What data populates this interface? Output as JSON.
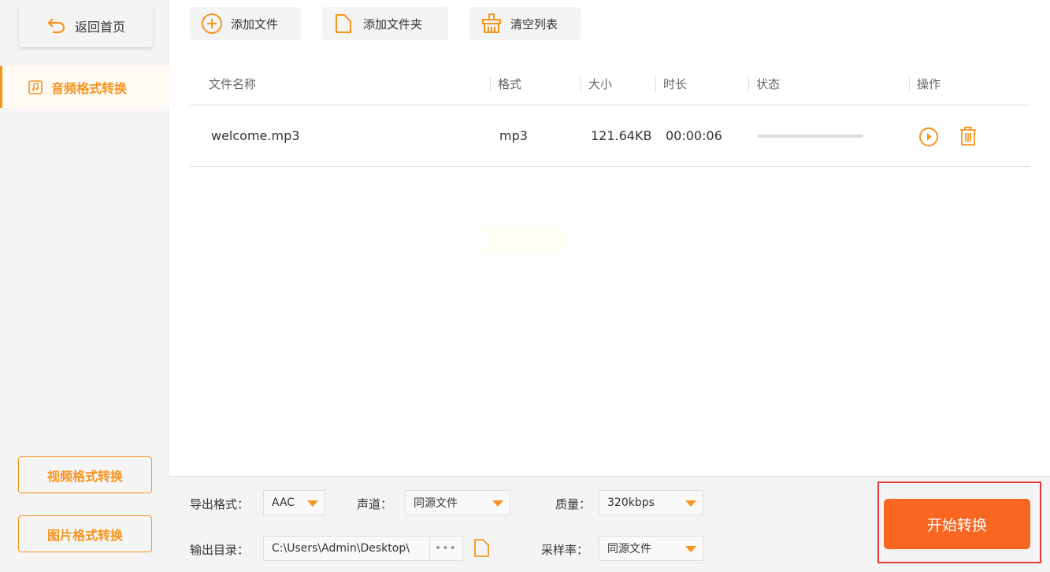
{
  "sidebar": {
    "back_label": "返回首页",
    "active_item": "音频格式转换",
    "video_label": "视频格式转换",
    "image_label": "图片格式转换"
  },
  "toolbar": {
    "add_file": "添加文件",
    "add_folder": "添加文件夹",
    "clear_list": "清空列表"
  },
  "table": {
    "headers": [
      "文件名称",
      "格式",
      "大小",
      "时长",
      "状态",
      "操作"
    ],
    "rows": [
      {
        "name": "welcome.mp3",
        "format": "mp3",
        "size": "121.64KB",
        "duration": "00:00:06",
        "progress": 0
      }
    ]
  },
  "watermark": "1765151667",
  "settings": {
    "format_label": "导出格式：",
    "format_value": "AAC",
    "channel_label": "声道：",
    "channel_value": "同源文件",
    "quality_label": "质量：",
    "quality_value": "320kbps",
    "output_label": "输出目录：",
    "output_value": "C:\\Users\\Admin\\Desktop\\",
    "browse": "•••",
    "sample_label": "采样率：",
    "sample_value": "同源文件"
  },
  "start_label": "开始转换",
  "colors": {
    "accent": "#f7941d",
    "start": "#f96621",
    "highlight": "#e0393a"
  }
}
